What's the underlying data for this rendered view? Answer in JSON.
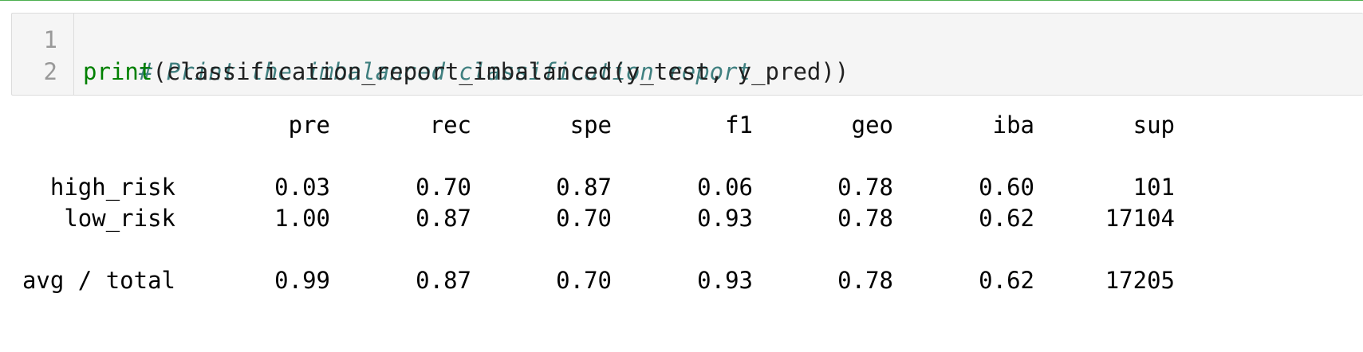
{
  "code": {
    "line_numbers": [
      "1",
      "2"
    ],
    "line1_comment": "# Print the imbalanced classification report",
    "line2_builtin": "print",
    "line2_rest": "(classification_report_imbalanced(y_test, y_pred))"
  },
  "report": {
    "headers": [
      "pre",
      "rec",
      "spe",
      "f1",
      "geo",
      "iba",
      "sup"
    ],
    "rows": [
      {
        "label": "high_risk",
        "values": [
          "0.03",
          "0.70",
          "0.87",
          "0.06",
          "0.78",
          "0.60",
          "101"
        ]
      },
      {
        "label": "low_risk",
        "values": [
          "1.00",
          "0.87",
          "0.70",
          "0.93",
          "0.78",
          "0.62",
          "17104"
        ]
      }
    ],
    "total": {
      "label": "avg / total",
      "values": [
        "0.99",
        "0.87",
        "0.70",
        "0.93",
        "0.78",
        "0.62",
        "17205"
      ]
    }
  },
  "colors": {
    "cell_border": "#4caf50",
    "input_bg": "#f5f5f5",
    "comment": "#408080",
    "builtin": "#008000"
  }
}
